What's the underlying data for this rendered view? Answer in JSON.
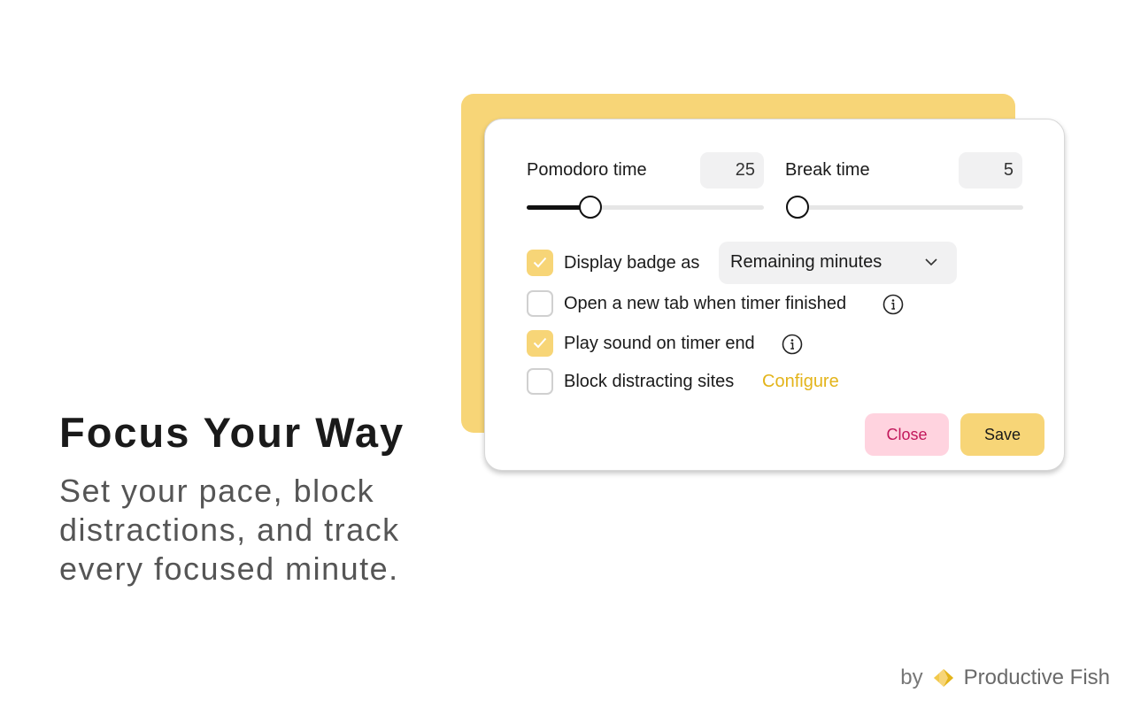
{
  "hero": {
    "title": "Focus Your Way",
    "subtitle_lines": [
      "Set your pace, block",
      "distractions, and track",
      "every focused minute."
    ]
  },
  "settings": {
    "pomodoro": {
      "label": "Pomodoro time",
      "value": "25",
      "slider_fraction": 0.27
    },
    "break": {
      "label": "Break time",
      "value": "5",
      "slider_fraction": 0.0
    },
    "options": [
      {
        "label": "Display badge as",
        "checked": true
      },
      {
        "label": "Open a new tab when timer finished",
        "checked": false,
        "icon": "info-icon"
      },
      {
        "label": "Play sound on timer end",
        "checked": true,
        "icon": "info-icon"
      },
      {
        "label": "Block distracting sites",
        "checked": false
      }
    ],
    "badge_select_value": "Remaining minutes",
    "configure_link": "Configure",
    "close_label": "Close",
    "save_label": "Save"
  },
  "footer": {
    "by": "by",
    "brand": "Productive Fish",
    "logo_icon": "fish-logo-icon"
  },
  "colors": {
    "accent_yellow": "#f7d577",
    "link_yellow": "#e3b41a",
    "close_bg": "#ffd3df",
    "close_text": "#c2185b"
  }
}
